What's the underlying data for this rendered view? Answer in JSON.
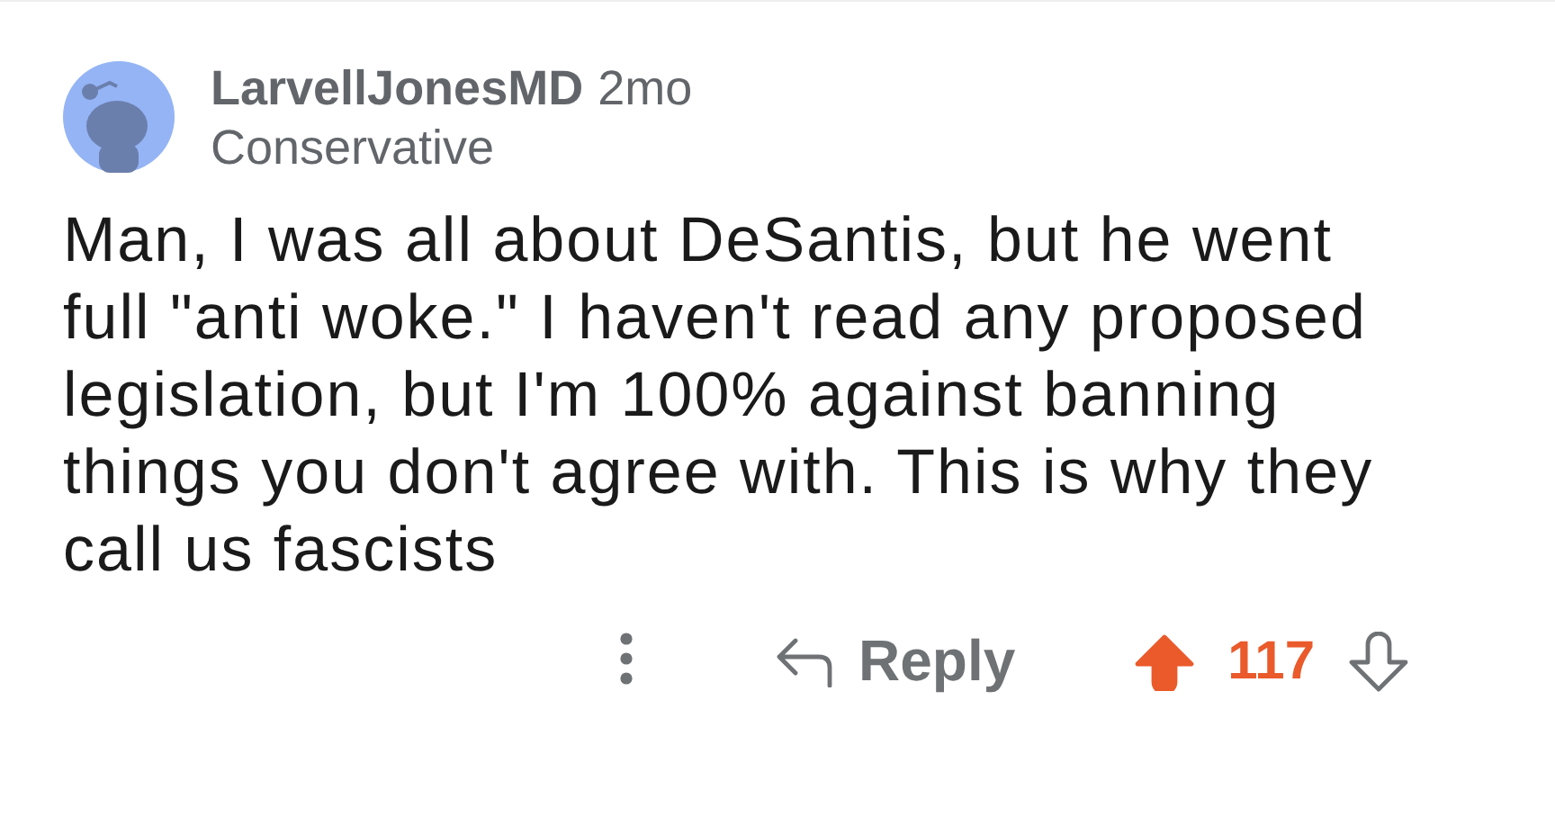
{
  "comment": {
    "author": "LarvellJonesMD",
    "age": "2mo",
    "community": "Conservative",
    "body": "Man, I was all about DeSantis, but he went full \"anti woke.\" I haven't read any proposed legislation, but I'm 100% against banning things you don't agree with. This is why they call us fascists",
    "reply_label": "Reply",
    "upvoted": true,
    "score": "117"
  }
}
